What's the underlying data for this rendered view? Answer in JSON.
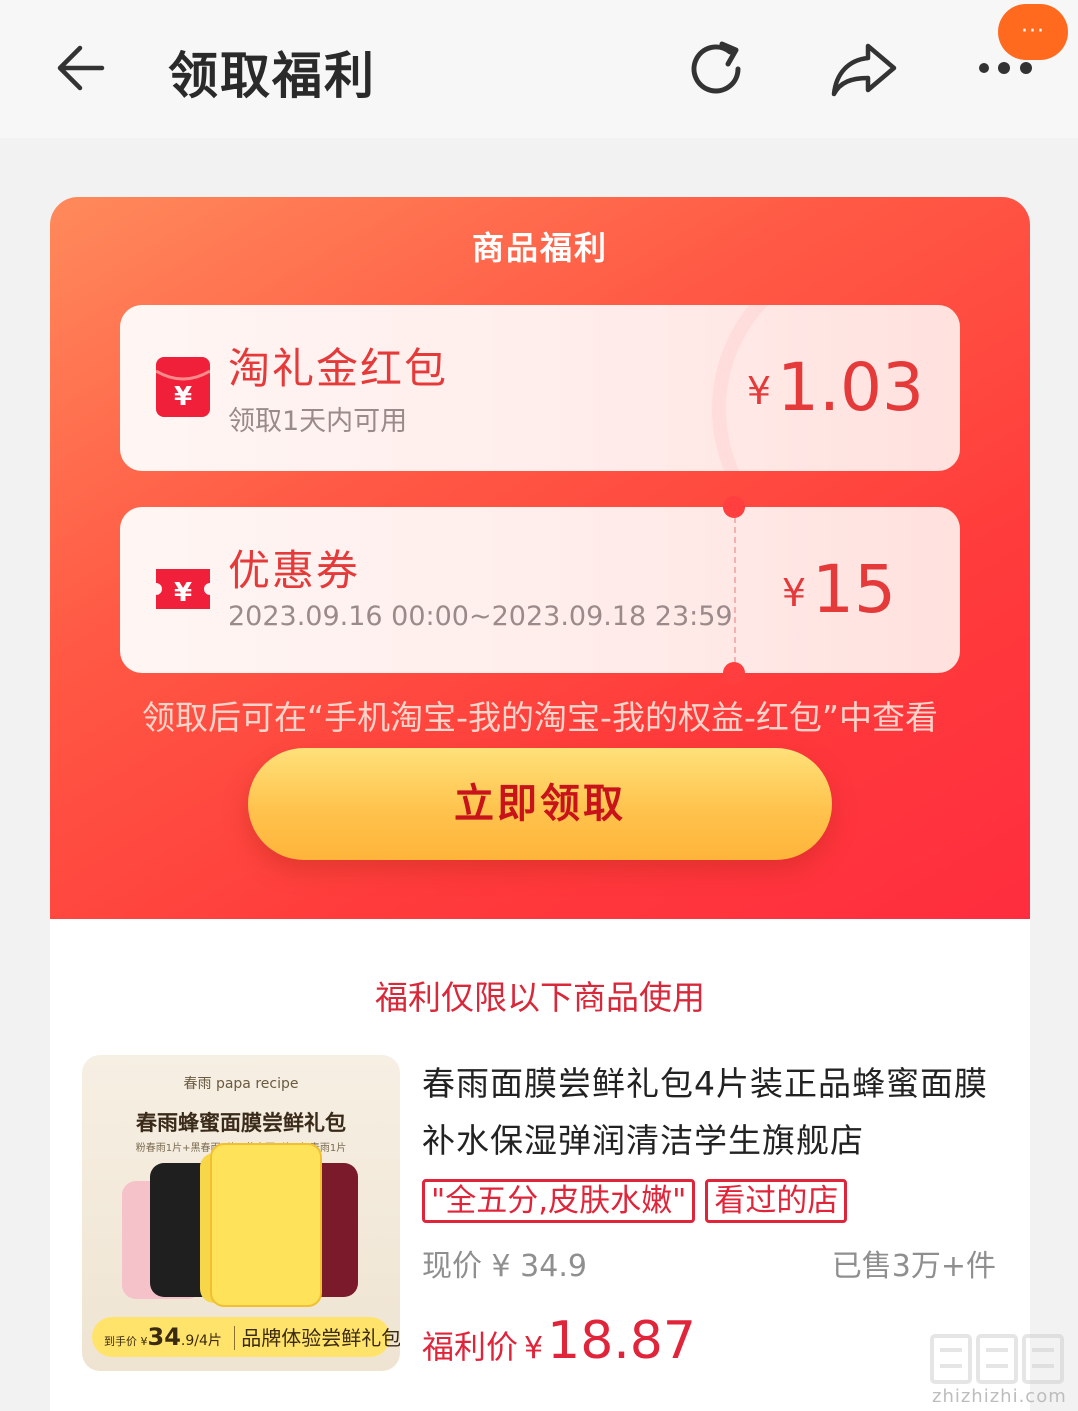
{
  "header": {
    "title": "领取福利",
    "float_badge": "···",
    "icons": [
      "back-arrow-icon",
      "refresh-icon",
      "share-icon",
      "more-icon"
    ]
  },
  "card": {
    "title": "商品福利",
    "red_packet": {
      "name": "淘礼金红包",
      "sub": "领取1天内可用",
      "currency": "¥",
      "amount": "1.03",
      "icon": "red-envelope-icon"
    },
    "coupon": {
      "name": "优惠券",
      "sub": "2023.09.16 00:00~2023.09.18 23:59",
      "currency": "¥",
      "amount": "15",
      "icon": "coupon-ticket-icon"
    },
    "notice": "领取后可在“手机淘宝-我的淘宝-我的权益-红包”中查看",
    "claim_label": "立即领取",
    "colors": {
      "gradient_start": "#ff8a5b",
      "gradient_end": "#ff2d3f",
      "button": "#ffc34d",
      "accent": "#e53a3a"
    }
  },
  "product": {
    "restrict_text": "福利仅限以下商品使用",
    "image": {
      "brand": "春雨 papa recipe",
      "title": "春雨蜂蜜面膜尝鲜礼包",
      "sub": "粉春雨1片+黑春雨1片+黄春雨1片+红春雨1片",
      "price_prefix": "到手价 ¥",
      "price_big": "34",
      "price_rest": ".9/4片",
      "price_label": "品牌体验尝鲜礼包"
    },
    "title": "春雨面膜尝鲜礼包4片装正品蜂蜜面膜补水保湿弹润清洁学生旗舰店",
    "tags": [
      "\"全五分,皮肤水嫩\"",
      "看过的店"
    ],
    "current_price": "现价 ¥ 34.9",
    "sold": "已售3万+件",
    "welfare_label": "福利价",
    "welfare_currency": "¥",
    "welfare_price": "18.87"
  },
  "watermark": "zhizhizhi.com"
}
